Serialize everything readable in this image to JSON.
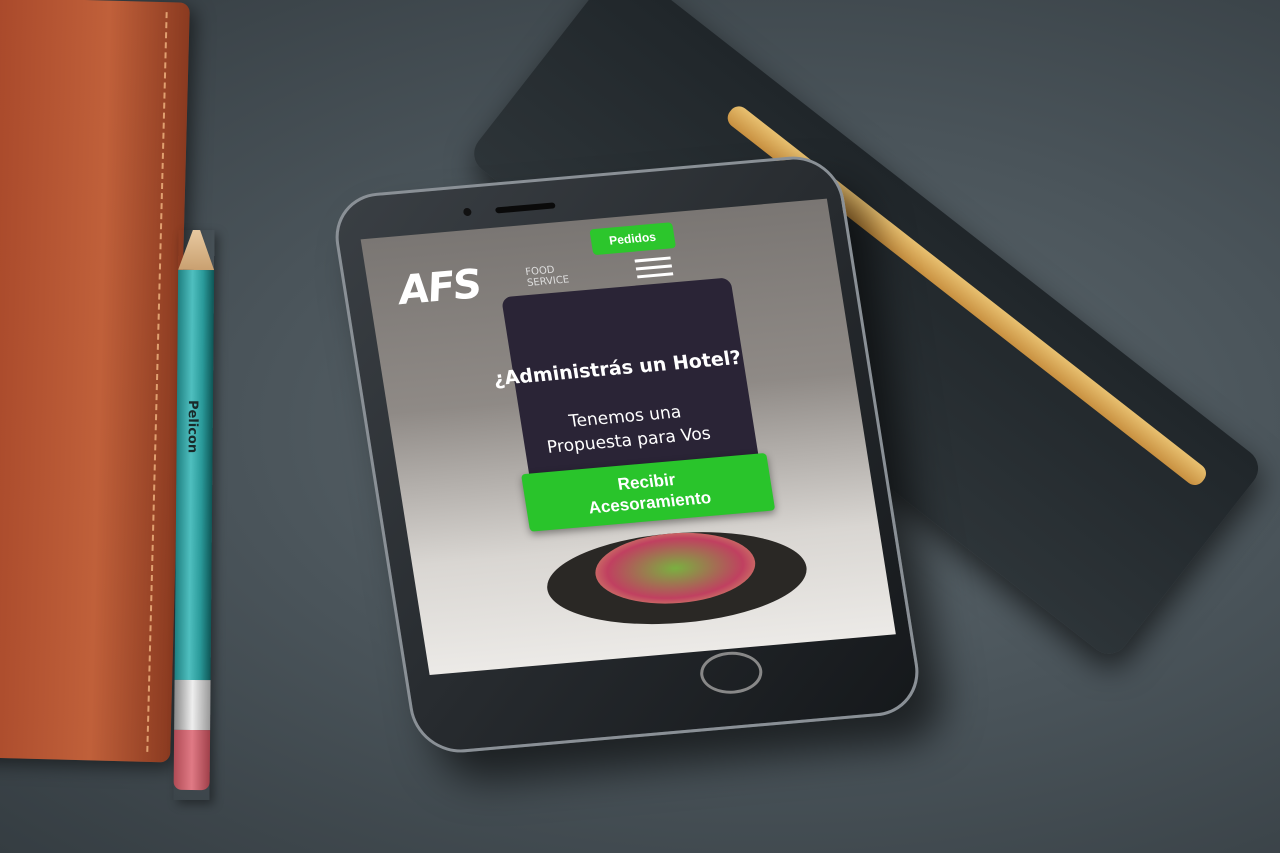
{
  "pencil": {
    "brand": "Pelicon"
  },
  "site": {
    "logo": "AFS",
    "logo_sub_1": "FOOD",
    "logo_sub_2": "SERVICE",
    "orders_label": "Pedidos",
    "menu_icon": "hamburger-icon",
    "heading": "¿Administrás un Hotel?",
    "subheading_1": "Tenemos una",
    "subheading_2": "Propuesta para Vos",
    "cta_1": "Recibir",
    "cta_2": "Acesoramiento",
    "accent": "#2cc62c"
  }
}
